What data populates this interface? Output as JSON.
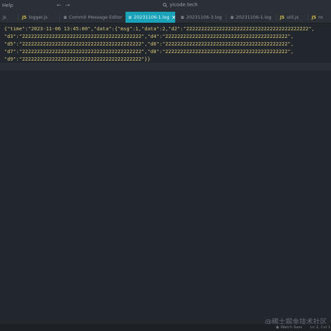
{
  "titlebar": {
    "menu_label": "Help",
    "search_text": "yicode.tech"
  },
  "tabs": [
    {
      "label": "js",
      "icon": "JS"
    },
    {
      "label": "logger.js",
      "icon": "JS"
    },
    {
      "label": "Commit Message Editor",
      "icon": "≡"
    },
    {
      "label": "20231106-1.log",
      "icon": "≡"
    },
    {
      "label": "20231106-3.log",
      "icon": "≡"
    },
    {
      "label": "20231106-1.log",
      "icon": "≡"
    },
    {
      "label": "util.js",
      "icon": "JS"
    },
    {
      "label": "ro",
      "icon": "JS"
    }
  ],
  "editor": {
    "lines": [
      "{\"time\":\"2023-11-06 13:45:00\",\"data\":{\"msg\":1,\"data\":2,\"d2\":\"22222222222222222222222222222222222222222\",",
      "\"d3\":\"2222222222222222222222222222222222222222\",\"d4\":\"22222222222222222222222222222222222222222\",",
      "\"d5\":\"2222222222222222222222222222222222222222\",\"d6\":\"22222222222222222222222222222222222222222\",",
      "\"d7\":\"2222222222222222222222222222222222222222\",\"d8\":\"22222222222222222222222222222222222222222\",",
      "\"d9\":\"2222222222222222222222222222222222222222\"}}"
    ]
  },
  "statusbar": {
    "watch_label": "Watch Sass",
    "position": "Ln 2, Col 1"
  },
  "watermark": "@稀土掘金技术社区"
}
